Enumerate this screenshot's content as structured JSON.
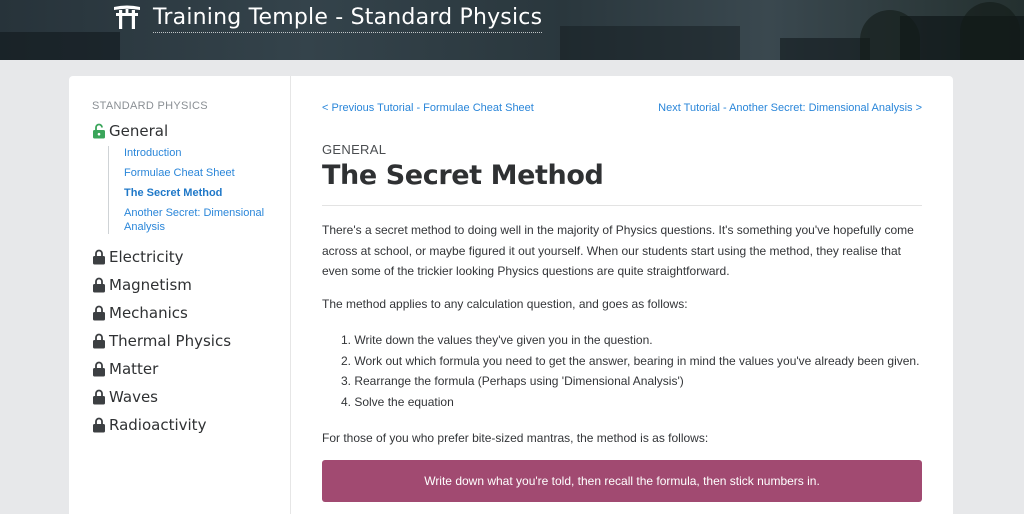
{
  "header": {
    "title": "Training Temple - Standard Physics",
    "icon": "torii-gate-icon"
  },
  "sidebar": {
    "heading": "STANDARD PHYSICS",
    "topics": [
      {
        "label": "General",
        "icon": "lock-open-icon",
        "unlocked": true,
        "subitems": [
          {
            "label": "Introduction",
            "active": false
          },
          {
            "label": "Formulae Cheat Sheet",
            "active": false
          },
          {
            "label": "The Secret Method",
            "active": true
          },
          {
            "label": "Another Secret: Dimensional Analysis",
            "active": false
          }
        ]
      },
      {
        "label": "Electricity",
        "icon": "lock-icon",
        "unlocked": false
      },
      {
        "label": "Magnetism",
        "icon": "lock-icon",
        "unlocked": false
      },
      {
        "label": "Mechanics",
        "icon": "lock-icon",
        "unlocked": false
      },
      {
        "label": "Thermal Physics",
        "icon": "lock-icon",
        "unlocked": false
      },
      {
        "label": "Matter",
        "icon": "lock-icon",
        "unlocked": false
      },
      {
        "label": "Waves",
        "icon": "lock-icon",
        "unlocked": false
      },
      {
        "label": "Radioactivity",
        "icon": "lock-icon",
        "unlocked": false
      }
    ]
  },
  "content": {
    "prev_link": "< Previous Tutorial - Formulae Cheat Sheet",
    "next_link": "Next Tutorial - Another Secret: Dimensional Analysis >",
    "section": "GENERAL",
    "title": "The Secret Method",
    "intro": "There's a secret method to doing well in the majority of Physics questions. It's something you've hopefully come across at school, or maybe figured it out yourself. When our students start using the method, they realise that even some of the trickier looking Physics questions are quite straightforward.",
    "method_intro": "The method applies to any calculation question, and goes as follows:",
    "steps": [
      "1. Write down the values they've given you in the question.",
      "2. Work out which formula you need to get the answer, bearing in mind the values you've already been given.",
      "3. Rearrange the formula (Perhaps using 'Dimensional Analysis')",
      "4. Solve the equation"
    ],
    "mantra_intro": "For those of you who prefer bite-sized mantras, the method is as follows:",
    "mantra": "Write down what you're told, then recall the formula, then stick numbers in."
  },
  "colors": {
    "link": "#2a86d9",
    "unlocked_lock": "#3aa55a",
    "locked": "#3c3f42",
    "mantra_bg": "#a14a71"
  }
}
